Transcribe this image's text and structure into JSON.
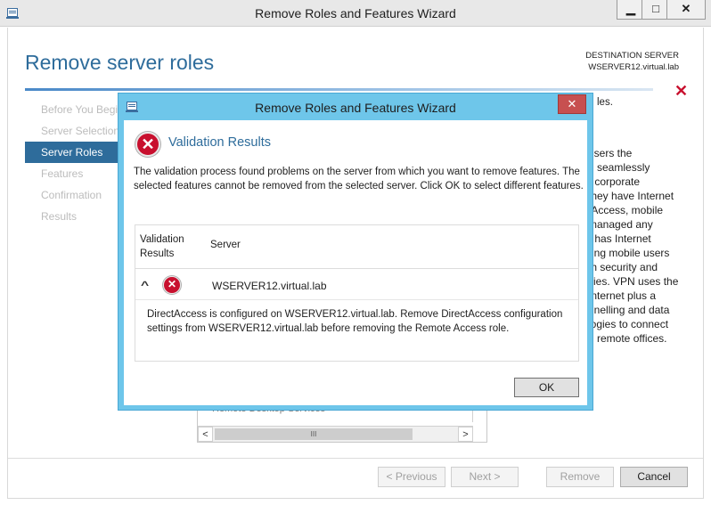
{
  "outer_window": {
    "title": "Remove Roles and Features Wizard",
    "minimize": "▁",
    "maximize": "□",
    "close": "✕"
  },
  "page": {
    "heading": "Remove server roles",
    "destination_label": "DESTINATION SERVER",
    "destination_server": "WSERVER12.virtual.lab",
    "close_icon": "✕"
  },
  "steps": [
    {
      "label": "Before You Begin",
      "active": false
    },
    {
      "label": "Server Selection",
      "active": false
    },
    {
      "label": "Server Roles",
      "active": true
    },
    {
      "label": "Features",
      "active": false
    },
    {
      "label": "Confirmation",
      "active": false
    },
    {
      "label": "Results",
      "active": false
    }
  ],
  "background_description": {
    "top": "les.",
    "lines": [
      "users the",
      "g seamlessly",
      "r corporate",
      "they have Internet",
      "tAccess, mobile",
      "managed any",
      "r has Internet",
      "ring mobile users",
      "th security and",
      "cies. VPN uses the",
      "Internet plus a",
      "nnelling and data",
      "logies to connect",
      "d remote offices."
    ]
  },
  "background_list": {
    "item": "Remote Desktop Services",
    "scroll_left": "<",
    "scroll_right": ">",
    "scroll_down": "⌄",
    "thumb_grip": "III"
  },
  "footer": {
    "previous": "< Previous",
    "next": "Next >",
    "remove": "Remove",
    "cancel": "Cancel"
  },
  "dialog": {
    "title": "Remove Roles and Features Wizard",
    "close": "✕",
    "heading": "Validation Results",
    "message": "The validation process found problems on the server from which you want to remove features. The selected features cannot be removed from the selected server.  Click OK to select different features.",
    "table": {
      "col_validation": "Validation Results",
      "col_server": "Server",
      "row_server": "WSERVER12.virtual.lab",
      "row_chevron": "^",
      "row_detail": "DirectAccess is configured on WSERVER12.virtual.lab. Remove DirectAccess configuration settings from WSERVER12.virtual.lab before removing the Remote Access role."
    },
    "ok": "OK",
    "error_icon_glyph": "✕"
  },
  "colors": {
    "accent": "#2e6c9b",
    "dialog_frame": "#6ec6ea",
    "error_red": "#c8102e",
    "close_red": "#c75050"
  }
}
